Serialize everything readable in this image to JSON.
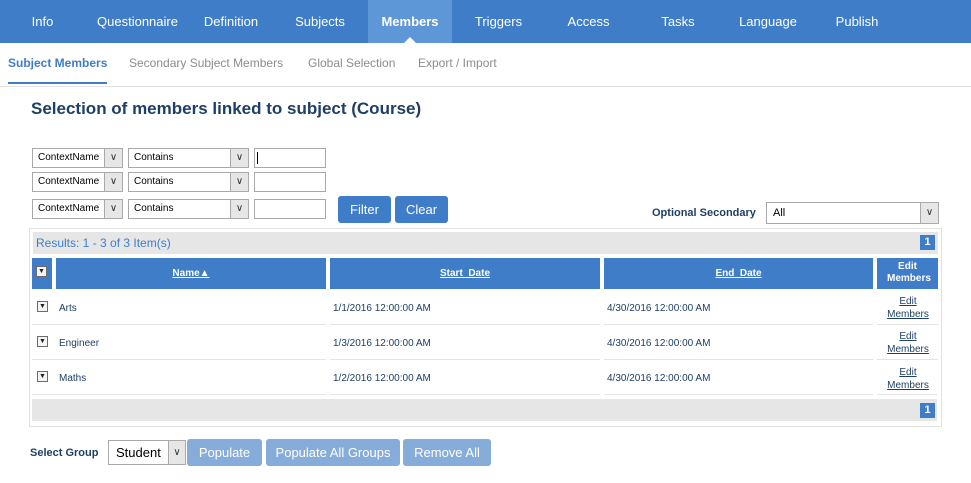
{
  "topnav": {
    "tabs": [
      {
        "label": "Info"
      },
      {
        "label": "Questionnaire"
      },
      {
        "label": "Definition"
      },
      {
        "label": "Subjects"
      },
      {
        "label": "Members",
        "active": true
      },
      {
        "label": "Triggers"
      },
      {
        "label": "Access"
      },
      {
        "label": "Tasks"
      },
      {
        "label": "Language"
      },
      {
        "label": "Publish"
      }
    ]
  },
  "subnav": {
    "tabs": [
      {
        "label": "Subject Members",
        "active": true
      },
      {
        "label": "Secondary Subject Members"
      },
      {
        "label": "Global Selection"
      },
      {
        "label": "Export / Import"
      }
    ]
  },
  "page_title": "Selection of members linked to subject (Course)",
  "filters": [
    {
      "field": "ContextName",
      "operator": "Contains",
      "value": ""
    },
    {
      "field": "ContextName",
      "operator": "Contains",
      "value": ""
    },
    {
      "field": "ContextName",
      "operator": "Contains",
      "value": ""
    }
  ],
  "filter_buttons": {
    "filter": "Filter",
    "clear": "Clear"
  },
  "optional_secondary": {
    "label": "Optional Secondary",
    "value": "All"
  },
  "grid": {
    "results_text": "Results: 1 - 3 of 3 Item(s)",
    "page": "1",
    "headers": {
      "name": "Name",
      "start_date": "Start_Date",
      "end_date": "End_Date",
      "edit_members": "Edit Members"
    },
    "rows": [
      {
        "name": "Arts",
        "start_date": "1/1/2016 12:00:00 AM",
        "end_date": "4/30/2016 12:00:00 AM",
        "edit": "Edit Members"
      },
      {
        "name": "Engineer",
        "start_date": "1/3/2016 12:00:00 AM",
        "end_date": "4/30/2016 12:00:00 AM",
        "edit": "Edit Members"
      },
      {
        "name": "Maths",
        "start_date": "1/2/2016 12:00:00 AM",
        "end_date": "4/30/2016 12:00:00 AM",
        "edit": "Edit Members"
      }
    ]
  },
  "group": {
    "label": "Select Group",
    "value": "Student",
    "populate": "Populate",
    "populate_all": "Populate All Groups",
    "remove_all": "Remove All"
  },
  "colors": {
    "primary": "#3f7dc9",
    "active_tab": "#5e97d8",
    "disabled_button": "#86acd9",
    "text": "#1e3f66"
  },
  "icons": {
    "sort": "sort-ascending-icon",
    "dropdown": "chevron-down-icon",
    "expand": "expand-row-icon"
  }
}
